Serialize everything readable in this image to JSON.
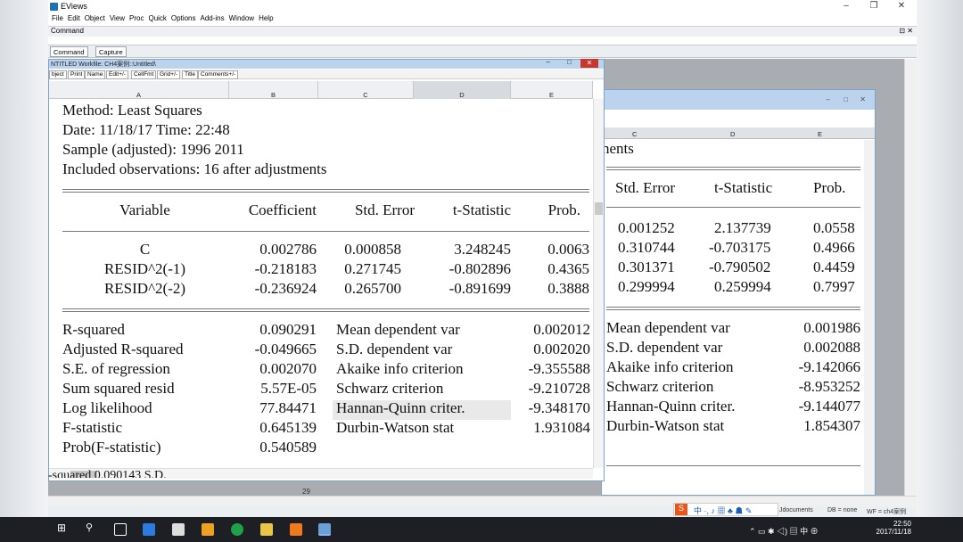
{
  "app": {
    "title": "EViews"
  },
  "menu": [
    "File",
    "Edit",
    "Object",
    "View",
    "Proc",
    "Quick",
    "Options",
    "Add-ins",
    "Window",
    "Help"
  ],
  "command": {
    "label": "Command",
    "tabs": [
      "Command",
      "Capture"
    ]
  },
  "front_window": {
    "caption": "NTITLED   Workfile: CH4案例::Untitled\\",
    "toolbar": [
      "bject",
      "Print",
      "Name",
      "Edit+/-",
      "CellFmt",
      "Grid+/-",
      "Title",
      "Comments+/-"
    ],
    "columns": [
      "A",
      "B",
      "C",
      "D",
      "E"
    ],
    "header": {
      "method": "Method: Least Squares",
      "date": "Date: 11/18/17   Time: 22:48",
      "sample": "Sample (adjusted): 1996 2011",
      "observations": "Included observations: 16 after adjustments"
    },
    "table": {
      "headers": [
        "Variable",
        "Coefficient",
        "Std. Error",
        "t-Statistic",
        "Prob."
      ],
      "rows": [
        [
          "C",
          "0.002786",
          "0.000858",
          "3.248245",
          "0.0063"
        ],
        [
          "RESID^2(-1)",
          "-0.218183",
          "0.271745",
          "-0.802896",
          "0.4365"
        ],
        [
          "RESID^2(-2)",
          "-0.236924",
          "0.265700",
          "-0.891699",
          "0.3888"
        ]
      ]
    },
    "stats_left": [
      {
        "label": "R-squared",
        "value": "0.090291"
      },
      {
        "label": "Adjusted R-squared",
        "value": "-0.049665"
      },
      {
        "label": "S.E. of regression",
        "value": "0.002070"
      },
      {
        "label": "Sum squared resid",
        "value": "5.57E-05"
      },
      {
        "label": "Log likelihood",
        "value": "77.84471"
      },
      {
        "label": "F-statistic",
        "value": "0.645139"
      },
      {
        "label": "Prob(F-statistic)",
        "value": "0.540589"
      }
    ],
    "stats_right": [
      {
        "label": "Mean dependent var",
        "value": "0.002012"
      },
      {
        "label": "S.D. dependent var",
        "value": "0.002020"
      },
      {
        "label": "Akaike info criterion",
        "value": "-9.355588"
      },
      {
        "label": "Schwarz criterion",
        "value": "-9.210728"
      },
      {
        "label": "Hannan-Quinn criter.",
        "value": "-9.348170"
      },
      {
        "label": "Durbin-Watson stat",
        "value": "1.931084"
      }
    ]
  },
  "back_window": {
    "columns": [
      "C",
      "D",
      "E"
    ],
    "header_fragment": "nents",
    "table_headers": [
      "Std. Error",
      "t-Statistic",
      "Prob."
    ],
    "rows": [
      [
        "0.001252",
        "2.137739",
        "0.0558"
      ],
      [
        "0.310744",
        "-0.703175",
        "0.4966"
      ],
      [
        "0.301371",
        "-0.790502",
        "0.4459"
      ],
      [
        "0.299994",
        "0.259994",
        "0.7997"
      ]
    ],
    "stats": [
      {
        "label": "Mean dependent var",
        "value": "0.001986"
      },
      {
        "label": "S.D. dependent var",
        "value": "0.002088"
      },
      {
        "label": "Akaike info criterion",
        "value": "-9.142066"
      },
      {
        "label": "Schwarz criterion",
        "value": "-8.953252"
      },
      {
        "label": "Hannan-Quinn criter.",
        "value": "-9.144077"
      },
      {
        "label": "Durbin-Watson stat",
        "value": "1.854307"
      }
    ],
    "row_number": "29"
  },
  "background": {
    "fragment": "-squared        0.090143   S.D."
  },
  "status": {
    "path": "Jdocuments",
    "db": "DB = none",
    "wf": "WF = ch4案例"
  },
  "taskbar": {
    "time": "22:50",
    "date": "2017/11/18"
  }
}
